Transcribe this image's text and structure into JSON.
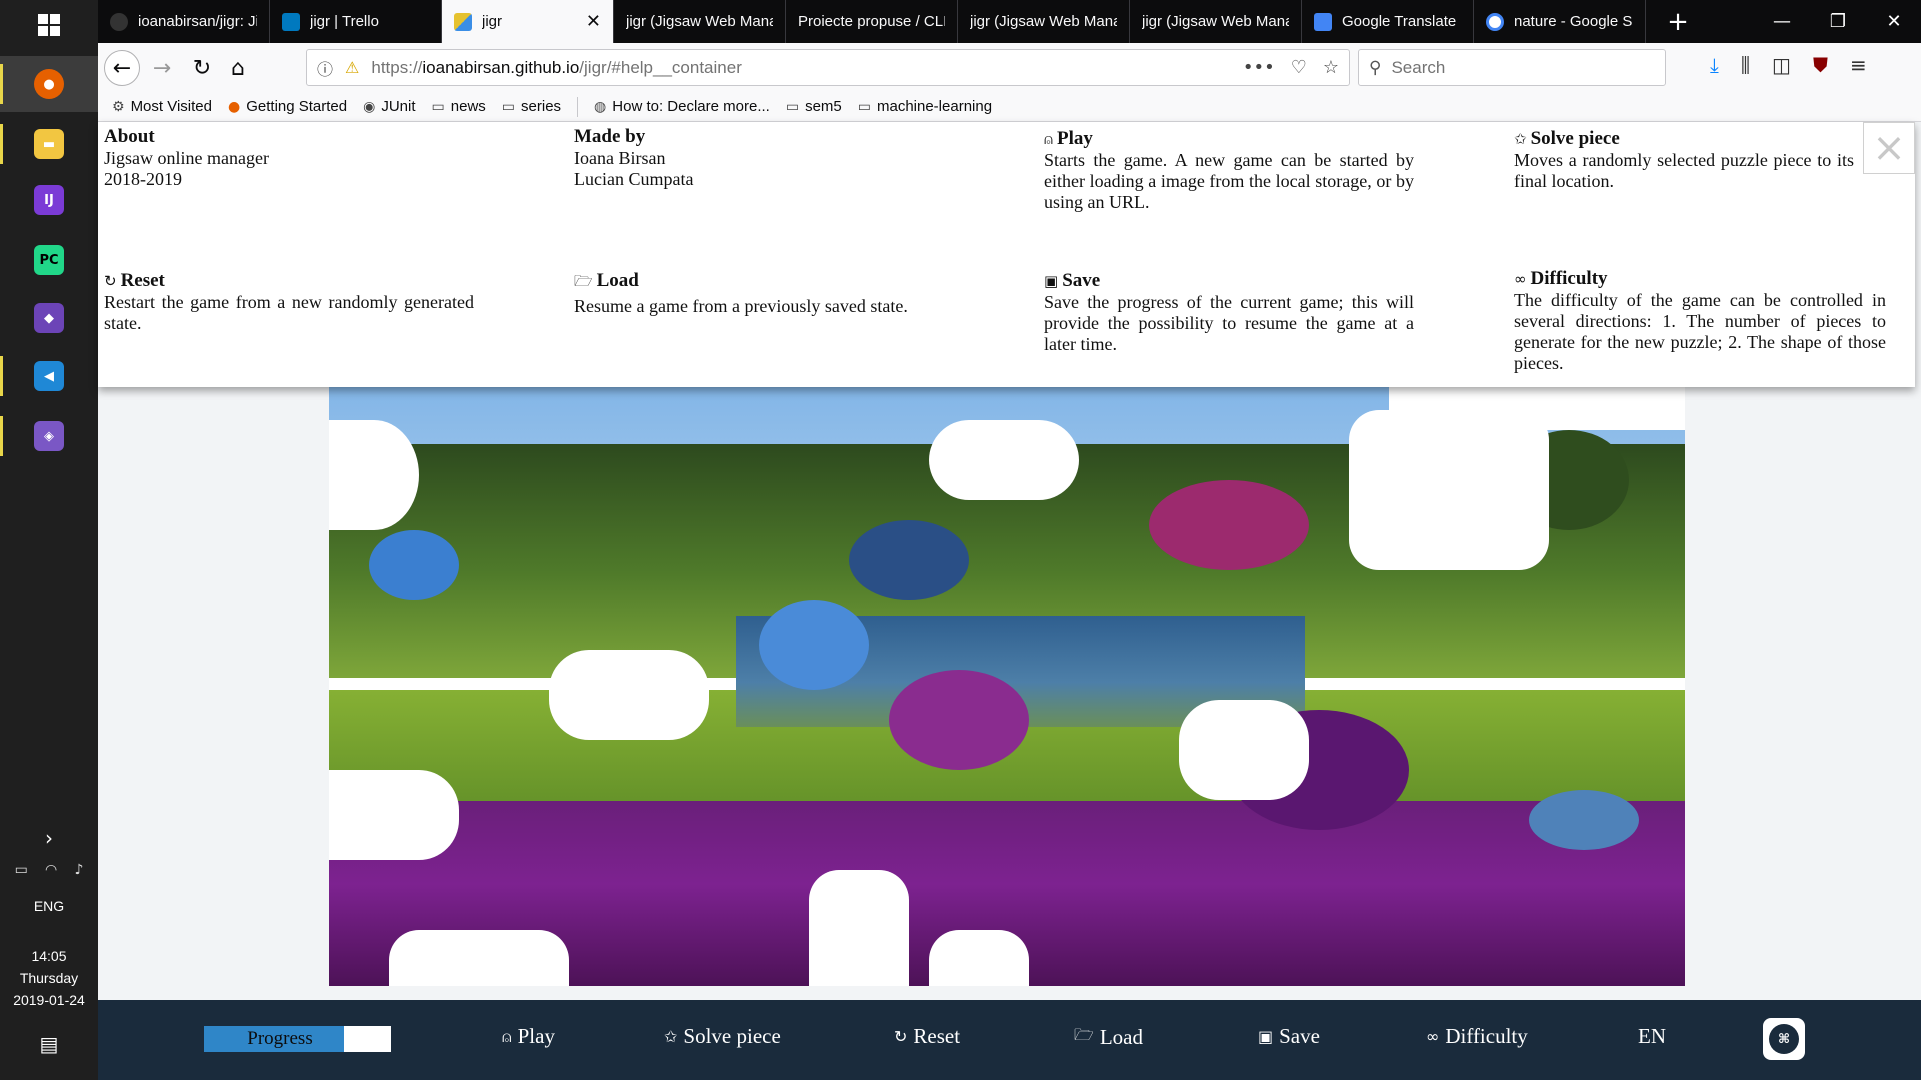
{
  "taskbar": {
    "apps": [
      {
        "icon": "firefox-icon",
        "color": "#e66000",
        "glyph": "●"
      },
      {
        "icon": "file-explorer-icon",
        "color": "#f2c641",
        "glyph": "▬"
      },
      {
        "icon": "intellij-icon",
        "color": "#7b3bd6",
        "glyph": "IJ"
      },
      {
        "icon": "pycharm-icon",
        "color": "#21d789",
        "glyph": "PC"
      },
      {
        "icon": "visual-studio-icon",
        "color": "#6c44b7",
        "glyph": "◆"
      },
      {
        "icon": "vscode-icon",
        "color": "#1f88d6",
        "glyph": "◀"
      },
      {
        "icon": "git-icon",
        "color": "#7a57c5",
        "glyph": "◈"
      }
    ],
    "language": "ENG",
    "time": "14:05",
    "day": "Thursday",
    "date": "2019-01-24"
  },
  "browser": {
    "tabs": [
      {
        "label": "ioanabirsan/jigr: Ji",
        "favicon": "github-icon",
        "color": "#333"
      },
      {
        "label": "jigr | Trello",
        "favicon": "trello-icon",
        "color": "#0079bf"
      },
      {
        "label": "jigr",
        "favicon": "jigr-icon",
        "color": "#e6c22e"
      },
      {
        "label": "jigr (Jigsaw Web Mana",
        "favicon": "",
        "color": ""
      },
      {
        "label": "Proiecte propuse / CLI",
        "favicon": "",
        "color": ""
      },
      {
        "label": "jigr (Jigsaw Web Mana",
        "favicon": "",
        "color": ""
      },
      {
        "label": "jigr (Jigsaw Web Mana",
        "favicon": "",
        "color": ""
      },
      {
        "label": "Google Translate",
        "favicon": "google-translate-icon",
        "color": "#4285f4"
      },
      {
        "label": "nature - Google Se",
        "favicon": "google-icon",
        "color": "#ffffff"
      }
    ],
    "url_prefix": "https://",
    "url_host": "ioanabirsan.github.io",
    "url_path": "/jigr/#help__container",
    "search_placeholder": "Search"
  },
  "bookmarks": [
    {
      "label": "Most Visited",
      "icon": "gear-icon"
    },
    {
      "label": "Getting Started",
      "icon": "firefox-icon"
    },
    {
      "label": "JUnit",
      "icon": "junit-icon"
    },
    {
      "label": "news",
      "icon": "folder-icon"
    },
    {
      "label": "series",
      "icon": "folder-icon"
    },
    {
      "label": "How to: Declare more...",
      "icon": "globe-icon"
    },
    {
      "label": "sem5",
      "icon": "folder-icon"
    },
    {
      "label": "machine-learning",
      "icon": "folder-icon"
    }
  ],
  "help": {
    "about": {
      "title": "About",
      "lines": [
        "Jigsaw online manager",
        "2018-2019"
      ]
    },
    "made_by": {
      "title": "Made by",
      "lines": [
        "Ioana Birsan",
        "Lucian Cumpata"
      ]
    },
    "play": {
      "title": "Play",
      "text": "Starts the game. A new game can be started by either loading a image from the local storage, or by using an URL."
    },
    "solve_piece": {
      "title": "Solve piece",
      "text": "Moves a randomly selected puzzle piece to its final location."
    },
    "reset": {
      "title": "Reset",
      "text": "Restart the game from a new randomly generated state."
    },
    "load": {
      "title": "Load",
      "text": "Resume a game from a previously saved state."
    },
    "save": {
      "title": "Save",
      "text": "Save the progress of the current game; this will provide the possibility to resume the game at a later time."
    },
    "difficulty": {
      "title": "Difficulty",
      "text": "The difficulty of the game can be controlled in several directions: 1. The number of pieces to generate for the new puzzle; 2. The shape of those pieces."
    },
    "close": "×"
  },
  "bottombar": {
    "progress_label": "Progress",
    "progress_value": 0.75,
    "play": "Play",
    "solve_piece": "Solve piece",
    "reset": "Reset",
    "load": "Load",
    "save": "Save",
    "difficulty": "Difficulty",
    "language": "EN"
  },
  "colors": {
    "bottom_bar": "#1a2b3c",
    "progress_fill": "#2f86c8",
    "page_bg": "#f2f4f6"
  }
}
